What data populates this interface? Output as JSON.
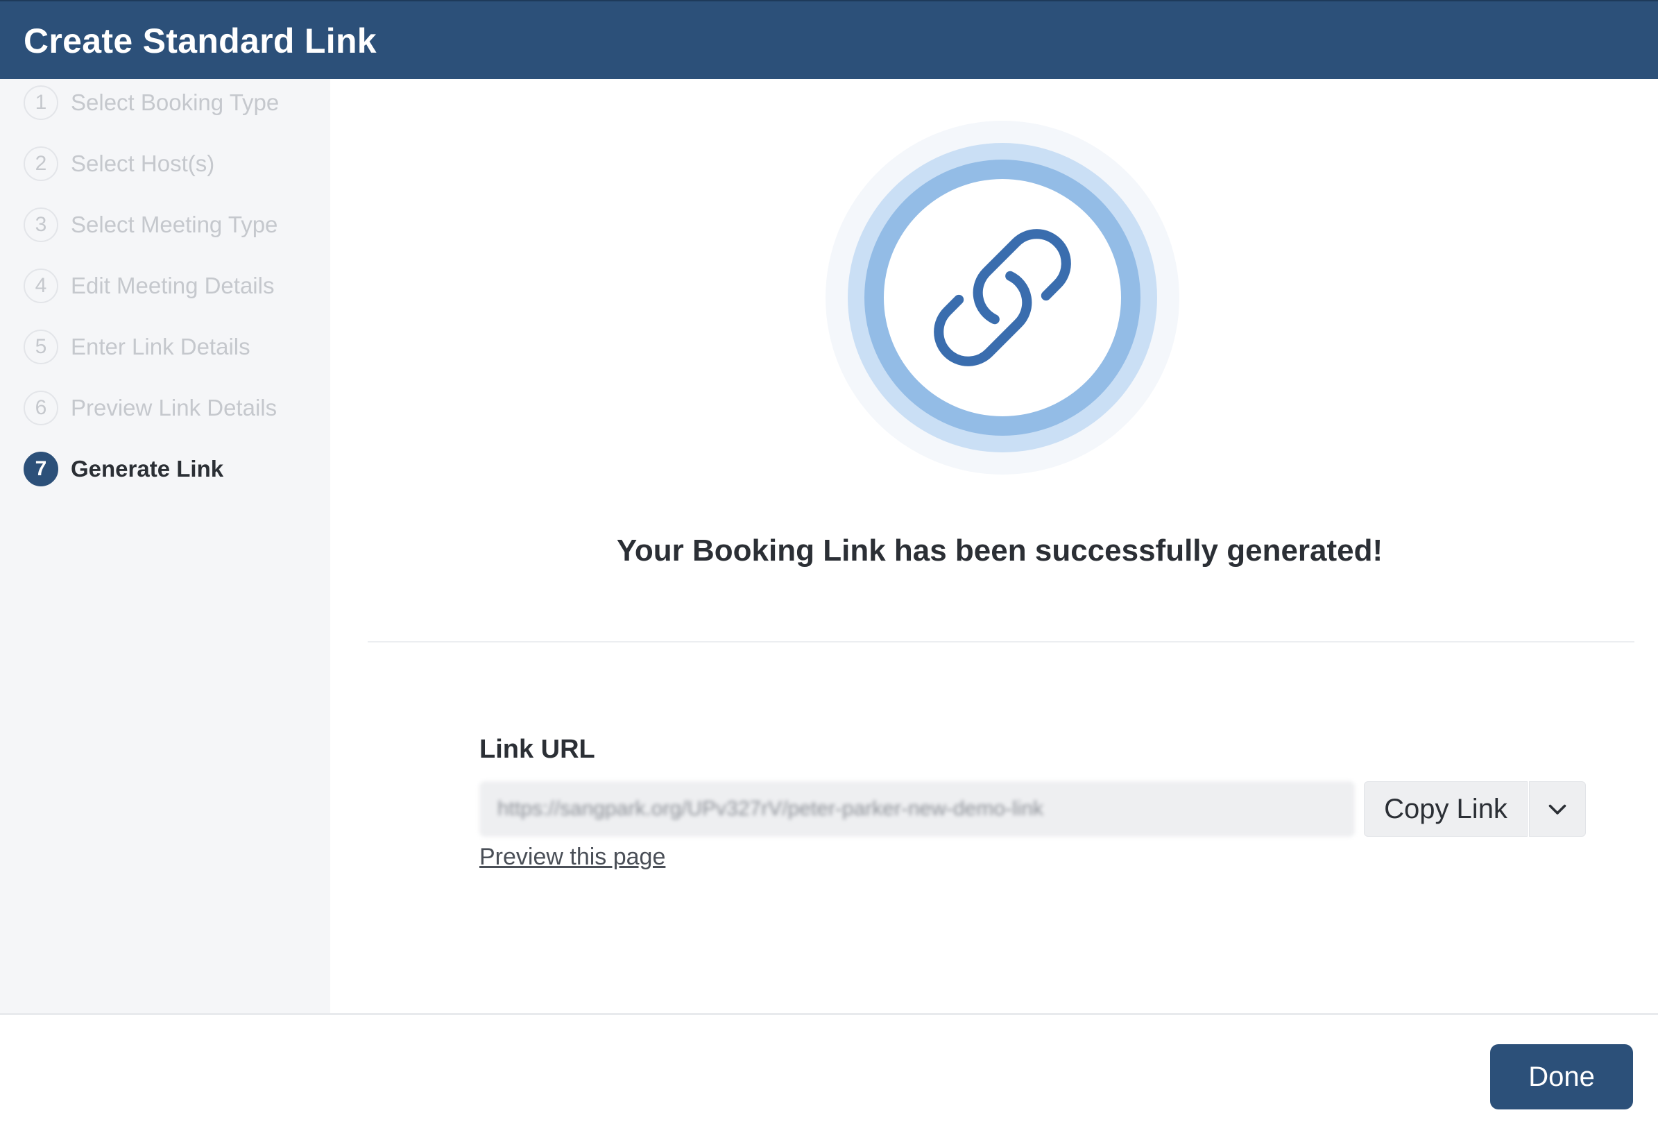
{
  "header": {
    "title": "Create Standard Link"
  },
  "sidebar": {
    "steps": [
      {
        "number": "1",
        "label": "Select Booking Type",
        "state": "inactive"
      },
      {
        "number": "2",
        "label": "Select Host(s)",
        "state": "inactive"
      },
      {
        "number": "3",
        "label": "Select Meeting Type",
        "state": "inactive"
      },
      {
        "number": "4",
        "label": "Edit Meeting Details",
        "state": "inactive"
      },
      {
        "number": "5",
        "label": "Enter Link Details",
        "state": "inactive"
      },
      {
        "number": "6",
        "label": "Preview Link Details",
        "state": "inactive"
      },
      {
        "number": "7",
        "label": "Generate Link",
        "state": "active"
      }
    ]
  },
  "main": {
    "hero_icon": "link-chain-icon",
    "success_message": "Your Booking Link has been successfully generated!",
    "link_field": {
      "label": "Link URL",
      "value": "https://sangpark.org/UPv327rV/peter-parker-new-demo-link"
    },
    "copy_button_label": "Copy Link",
    "copy_dropdown_icon": "chevron-down-icon",
    "preview_link_text": "Preview this page"
  },
  "footer": {
    "done_label": "Done"
  },
  "colors": {
    "primary": "#2c5079",
    "sidebar_bg": "#f5f6f8",
    "ring_light": "#cadff5",
    "ring_mid": "#93bce6",
    "icon_blue": "#3a6dae",
    "inactive_text": "#c5c8cd",
    "text_dark": "#2b2f35"
  }
}
